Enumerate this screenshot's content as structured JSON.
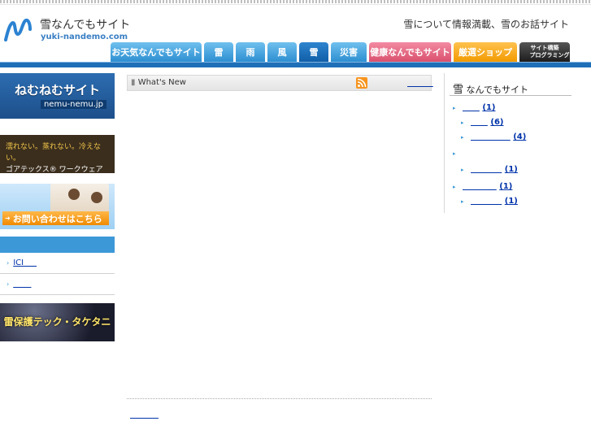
{
  "site": {
    "name": "雪なんでもサイト",
    "url": "yuki-nandemo.com",
    "tagline": "雪について情報満載、雪のお話サイト"
  },
  "nav": {
    "tabs": [
      {
        "label": "お天気なんでもサイト"
      },
      {
        "label": "雷"
      },
      {
        "label": "雨"
      },
      {
        "label": "風"
      },
      {
        "label": "雪"
      },
      {
        "label": "災害"
      },
      {
        "label": "健康なんでもサイト"
      },
      {
        "label": "厳選ショップ"
      },
      {
        "label_line1": "サイト構築",
        "label_line2": "プログラミング"
      }
    ],
    "active": "雪"
  },
  "left": {
    "nemu": {
      "title": "ねむねむサイト",
      "url": "nemu-nemu.jp"
    },
    "gore": {
      "line1": "濡れない。蒸れない。冷えない。",
      "line2": "ゴアテックス® ワークウェア"
    },
    "contact": {
      "button": "お問い合わせはこちら"
    },
    "links": [
      {
        "text": "ICI"
      },
      {
        "text": ""
      }
    ],
    "lightning": {
      "title": "雷保護テック・タケタニ"
    }
  },
  "main": {
    "heading": "What's New"
  },
  "right": {
    "title_kanji": "雪",
    "title_rest": " なんでもサイト",
    "categories": [
      {
        "count": "(1)"
      },
      {
        "count": "(6)"
      },
      {
        "count": "(4)"
      },
      {
        "count": "(1)"
      },
      {
        "count": "(1)"
      },
      {
        "count": "(1)"
      }
    ]
  }
}
